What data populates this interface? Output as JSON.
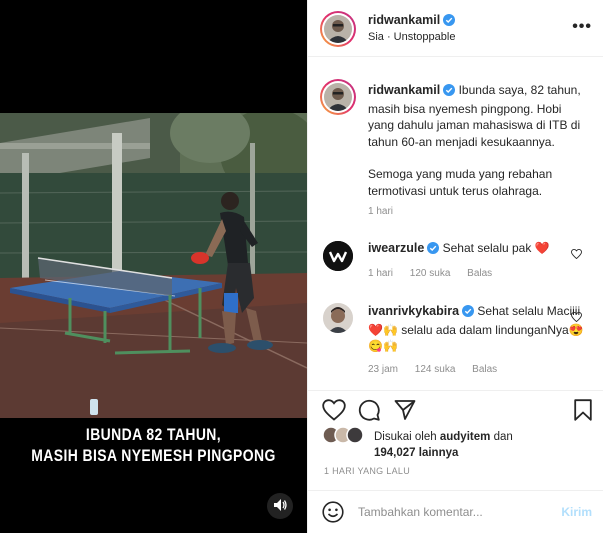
{
  "post": {
    "username": "ridwankamil",
    "audio": "Sia · Unstoppable",
    "more_label": "•••"
  },
  "media": {
    "caption_line1": "IBUNDA 82 TAHUN,",
    "caption_line2": "MASIH BISA NYEMESH PINGPONG"
  },
  "caption_comment": {
    "username": "ridwankamil",
    "text": "Ibunda saya, 82 tahun, masih bisa nyemesh pingpong. Hobi yang dahulu jaman mahasiswa di ITB di tahun 60-an menjadi kesukaannya.",
    "text2": "Semoga yang muda yang rebahan termotivasi untuk terus olahraga.",
    "time": "1 hari"
  },
  "comments": [
    {
      "username": "iwearzule",
      "text": "Sehat selalu pak ❤️",
      "time": "1 hari",
      "likes": "120 suka",
      "reply": "Balas"
    },
    {
      "username": "ivanrivkykabira",
      "text": "Sehat selalu Maciiii❤️🙌 selalu ada dalam lindunganNya😍😋🙌",
      "time": "23 jam",
      "likes": "124 suka",
      "reply": "Balas"
    }
  ],
  "likes": {
    "prefix": "Disukai oleh",
    "user": "audyitem",
    "conj": "dan",
    "count": "194,027 lainnya"
  },
  "date": "1 HARI YANG LALU",
  "add_comment": {
    "placeholder": "Tambahkan komentar...",
    "post_label": "Kirim"
  },
  "icons": {
    "verified": "verified-badge-icon",
    "like": "heart-icon",
    "comment": "comment-icon",
    "share": "paper-plane-icon",
    "save": "bookmark-icon",
    "emoji": "smiley-icon",
    "sound": "speaker-icon"
  },
  "colors": {
    "verified": "#3897f0",
    "muted": "#8e8e8e",
    "post_button": "#b2dffc",
    "heart_red": "#ed4956"
  }
}
